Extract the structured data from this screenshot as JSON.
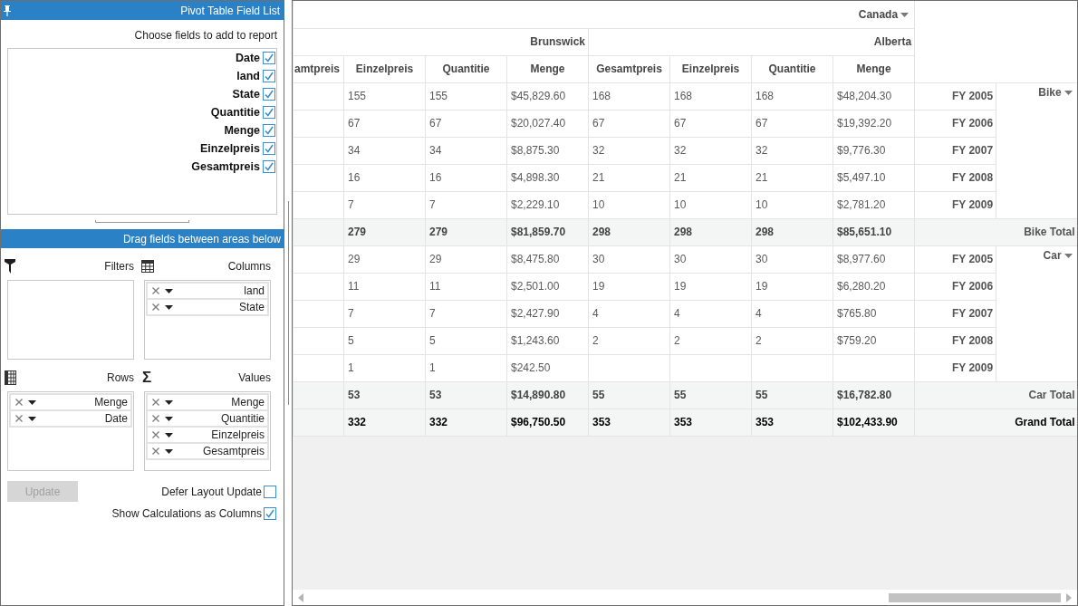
{
  "field_list": {
    "title": "Pivot Table Field List",
    "instruction": "Choose fields to add to report",
    "fields": [
      {
        "label": "Date",
        "checked": true
      },
      {
        "label": "land",
        "checked": true
      },
      {
        "label": "State",
        "checked": true
      },
      {
        "label": "Quantitie",
        "checked": true
      },
      {
        "label": "Menge",
        "checked": true
      },
      {
        "label": "Einzelpreis",
        "checked": true
      },
      {
        "label": "Gesamtpreis",
        "checked": true
      }
    ]
  },
  "areas_section": {
    "title": "Drag fields between areas below",
    "areas": [
      {
        "kind": "filters",
        "label": "Filters"
      },
      {
        "kind": "columns",
        "label": "Columns",
        "items": [
          "land",
          "State"
        ]
      },
      {
        "kind": "rows",
        "label": "Rows",
        "items": [
          "Menge",
          "Date"
        ]
      },
      {
        "kind": "values",
        "label": "Values",
        "symbol": "Σ",
        "items": [
          "Menge",
          "Quantitie",
          "Einzelpreis",
          "Gesamtpreis"
        ]
      }
    ]
  },
  "update_button": {
    "label": "Update",
    "disabled": true
  },
  "options": [
    {
      "label": "Defer Layout Update",
      "checked": false
    },
    {
      "label": "Show Calculations as Columns",
      "checked": true
    }
  ],
  "pivot": {
    "country": "Canada",
    "states": [
      {
        "label": "Brunswick",
        "measures": [
          "amtpreis",
          "Einzelpreis",
          "Quantitie",
          "Menge"
        ]
      },
      {
        "label": "Alberta",
        "measures": [
          "Gesamtpreis",
          "Einzelpreis",
          "Quantitie",
          "Menge"
        ]
      }
    ],
    "groups": [
      {
        "label": "Bike",
        "rows": [
          {
            "label": "FY 2005",
            "cells": [
              "155",
              "155",
              "$45,829.60",
              "168",
              "168",
              "168",
              "$48,204.30"
            ]
          },
          {
            "label": "FY 2006",
            "cells": [
              "67",
              "67",
              "$20,027.40",
              "67",
              "67",
              "67",
              "$19,392.20"
            ]
          },
          {
            "label": "FY 2007",
            "cells": [
              "34",
              "34",
              "$8,875.30",
              "32",
              "32",
              "32",
              "$9,776.30"
            ]
          },
          {
            "label": "FY 2008",
            "cells": [
              "16",
              "16",
              "$4,898.30",
              "21",
              "21",
              "21",
              "$5,497.10"
            ]
          },
          {
            "label": "FY 2009",
            "cells": [
              "7",
              "7",
              "$2,229.10",
              "10",
              "10",
              "10",
              "$2,781.20"
            ]
          }
        ],
        "total": {
          "label": "Bike Total",
          "cells": [
            "279",
            "279",
            "$81,859.70",
            "298",
            "298",
            "298",
            "$85,651.10"
          ]
        }
      },
      {
        "label": "Car",
        "rows": [
          {
            "label": "FY 2005",
            "cells": [
              "29",
              "29",
              "$8,475.80",
              "30",
              "30",
              "30",
              "$8,977.60"
            ]
          },
          {
            "label": "FY 2006",
            "cells": [
              "11",
              "11",
              "$2,501.00",
              "19",
              "19",
              "19",
              "$6,280.20"
            ]
          },
          {
            "label": "FY 2007",
            "cells": [
              "7",
              "7",
              "$2,427.90",
              "4",
              "4",
              "4",
              "$765.80"
            ]
          },
          {
            "label": "FY 2008",
            "cells": [
              "5",
              "5",
              "$1,243.60",
              "2",
              "2",
              "2",
              "$759.20"
            ]
          },
          {
            "label": "FY 2009",
            "cells": [
              "1",
              "1",
              "$242.50"
            ]
          }
        ],
        "total": {
          "label": "Car Total",
          "cells": [
            "53",
            "53",
            "$14,890.80",
            "55",
            "55",
            "55",
            "$16,782.80"
          ]
        }
      }
    ],
    "grand_total": {
      "label": "Grand Total",
      "cells": [
        "332",
        "332",
        "$96,750.50",
        "353",
        "353",
        "353",
        "$102,433.90"
      ]
    }
  }
}
